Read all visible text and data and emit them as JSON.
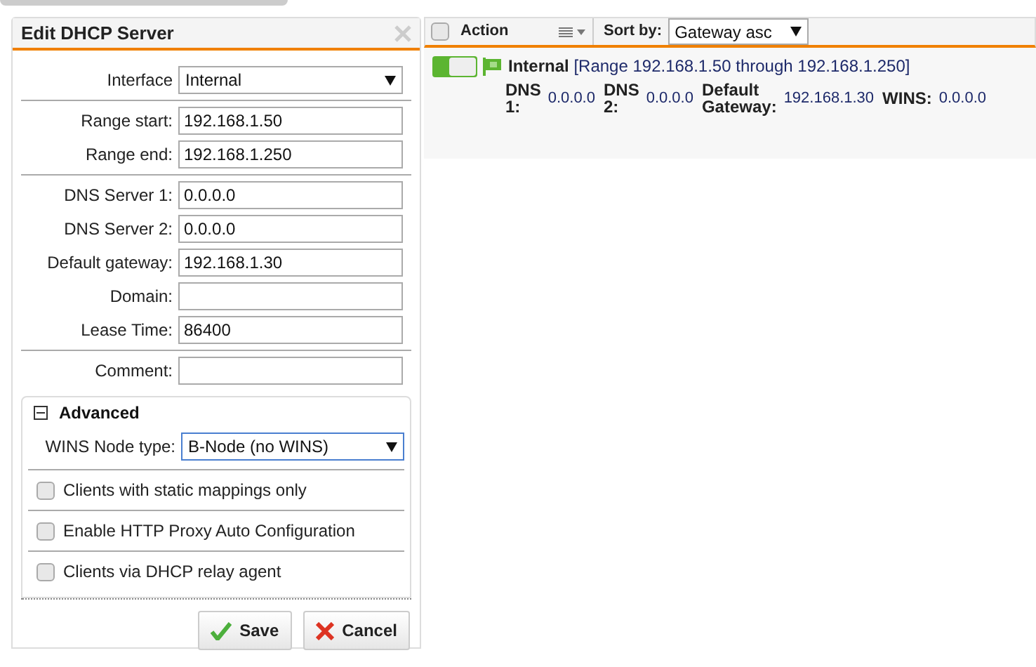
{
  "dialog": {
    "title": "Edit DHCP Server",
    "groups": [
      [
        {
          "kind": "select",
          "label": "Interface",
          "value": "Internal"
        }
      ],
      [
        {
          "kind": "input",
          "label": "Range start:",
          "value": "192.168.1.50"
        },
        {
          "kind": "input",
          "label": "Range end:",
          "value": "192.168.1.250"
        }
      ],
      [
        {
          "kind": "input",
          "label": "DNS Server 1:",
          "value": "0.0.0.0"
        },
        {
          "kind": "input",
          "label": "DNS Server 2:",
          "value": "0.0.0.0"
        },
        {
          "kind": "input",
          "label": "Default gateway:",
          "value": "192.168.1.30"
        },
        {
          "kind": "input",
          "label": "Domain:"
        },
        {
          "kind": "input",
          "label": "Lease Time:",
          "value": "86400"
        }
      ],
      [
        {
          "kind": "input",
          "label": "Comment:"
        }
      ]
    ],
    "advanced": {
      "title": "Advanced",
      "expanded": true,
      "wins": {
        "label": "WINS Node type:",
        "value": "B-Node (no WINS)"
      },
      "options": [
        {
          "label": "Clients with static mappings only",
          "checked": false
        },
        {
          "label": "Enable HTTP Proxy Auto Configuration",
          "checked": false
        },
        {
          "label": "Clients via DHCP relay agent",
          "checked": false
        }
      ]
    },
    "buttons": [
      {
        "kind": "save",
        "label": "Save"
      },
      {
        "kind": "cancel",
        "label": "Cancel"
      }
    ]
  },
  "list": {
    "select_all": {
      "checked": false
    },
    "action": "Action",
    "sort_label": "Sort by:",
    "sort_value": "Gateway asc",
    "rows": [
      {
        "on": true,
        "name": "Internal",
        "range": "[Range 192.168.1.50 through 192.168.1.250]",
        "details": [
          {
            "label": "DNS 1:",
            "value": "0.0.0.0"
          },
          {
            "label": "DNS 2:",
            "value": "0.0.0.0"
          },
          {
            "label": "Default Gateway:",
            "value": "192.168.1.30"
          },
          {
            "label": "WINS:",
            "value": "0.0.0.0"
          }
        ]
      }
    ]
  }
}
